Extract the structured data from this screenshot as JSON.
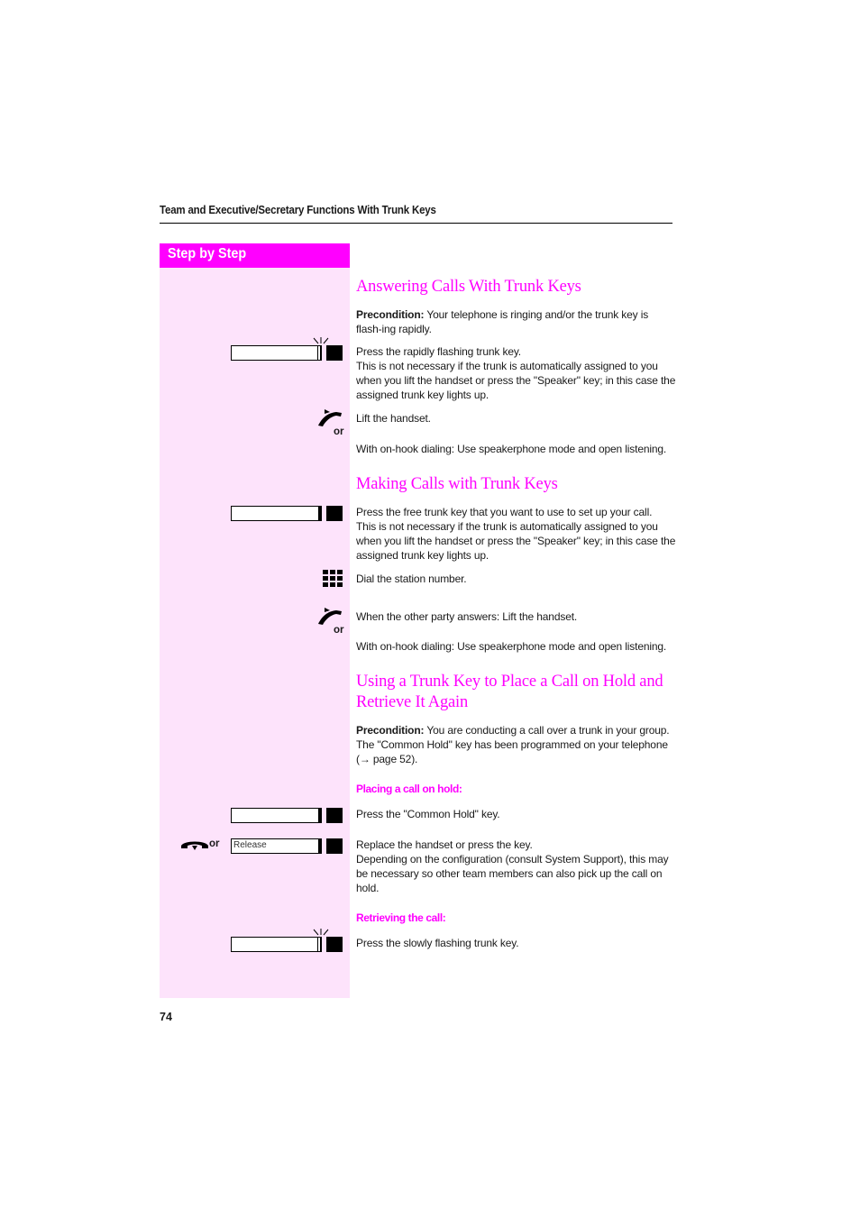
{
  "running_head": "Team and Executive/Secretary Functions With Trunk Keys",
  "step_by_step_label": "Step by Step",
  "page_number": "74",
  "colors": {
    "accent": "#ff00ff",
    "sidebar_bg": "#fde3fb"
  },
  "sections": [
    {
      "title": "Answering Calls With Trunk Keys",
      "precondition_label": "Precondition:",
      "precondition_text": " Your telephone is ringing and/or the trunk key is flash-ing rapidly.",
      "steps": [
        {
          "icon": "trunk-key-flashing",
          "text": "Press the rapidly flashing trunk key.\nThis is not necessary if the trunk is automatically assigned to you when you lift the handset or press the \"Speaker\" key; in this case the assigned trunk key lights up."
        },
        {
          "icon": "handset-lift",
          "or_label": "or",
          "text": "Lift the handset."
        },
        {
          "icon": "",
          "text": "With on-hook dialing: Use speakerphone mode and open listening."
        }
      ]
    },
    {
      "title": "Making Calls with Trunk Keys",
      "steps": [
        {
          "icon": "trunk-key",
          "text": "Press the free trunk key that you want to use to set up your call.\nThis is not necessary if the trunk is automatically assigned to you when you lift the handset or press the \"Speaker\" key; in this case the assigned trunk key lights up."
        },
        {
          "icon": "keypad",
          "text": "Dial the station number."
        },
        {
          "icon": "handset-lift",
          "or_label": "or",
          "text": "When the other party answers: Lift the handset."
        },
        {
          "icon": "",
          "text": "With on-hook dialing: Use speakerphone mode and open listening."
        }
      ]
    },
    {
      "title_line1": "Using a Trunk Key to Place a Call on Hold and",
      "title_line2": "Retrieve It Again",
      "precondition_label": "Precondition:",
      "precondition_line1": " You are conducting a call over a trunk in your group.",
      "precondition_line2": "The \"Common Hold\" key has been programmed on your telephone",
      "precondition_line3": "(→ page 52).",
      "subheads": {
        "placing": "Placing a call on hold:",
        "retrieving": "Retrieving the call:"
      },
      "steps": [
        {
          "icon": "trunk-key",
          "text": "Press the \"Common Hold\" key."
        },
        {
          "icon": "handset-replace",
          "or_label": "or",
          "key_label": "Release",
          "text": "Replace the handset or press the key.\nDepending on the configuration (consult System Support), this may be necessary so other team members can also pick up the call on hold."
        },
        {
          "icon": "trunk-key-flashing",
          "text": "Press the slowly flashing trunk key."
        }
      ]
    }
  ]
}
